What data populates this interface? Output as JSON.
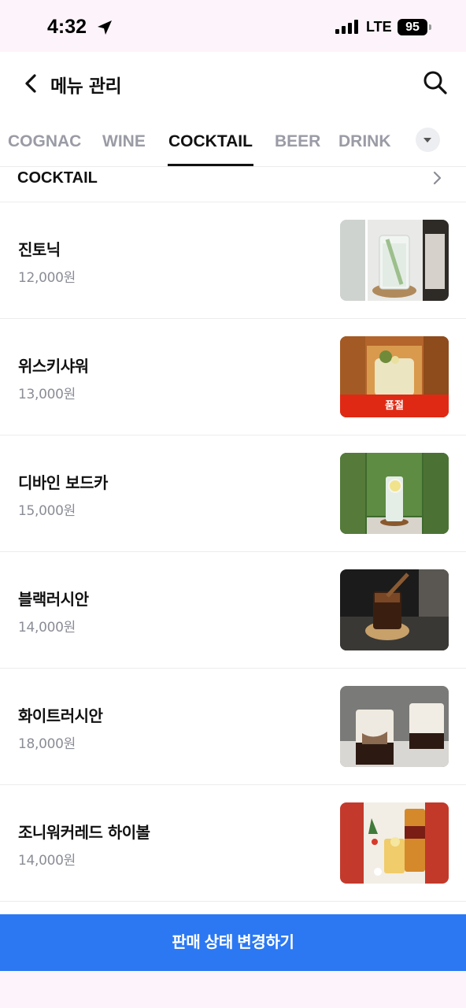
{
  "status_bar": {
    "time": "4:32",
    "network": "LTE",
    "battery": "95"
  },
  "header": {
    "title": "메뉴 관리"
  },
  "tabs": [
    {
      "label": "COGNAC",
      "active": false
    },
    {
      "label": "WINE",
      "active": false
    },
    {
      "label": "COCKTAIL",
      "active": true
    },
    {
      "label": "BEER",
      "active": false
    },
    {
      "label": "DRINK",
      "active": false
    }
  ],
  "section": {
    "title": "COCKTAIL"
  },
  "menu_items": [
    {
      "name": "진토닉",
      "price": "12,000원",
      "image": "gin-tonic-photo",
      "sold_out": false
    },
    {
      "name": "위스키샤워",
      "price": "13,000원",
      "image": "whisky-sour-photo",
      "sold_out": true,
      "badge": "품절"
    },
    {
      "name": "디바인 보드카",
      "price": "15,000원",
      "image": "divine-vodka-photo",
      "sold_out": false
    },
    {
      "name": "블랙러시안",
      "price": "14,000원",
      "image": "black-russian-photo",
      "sold_out": false
    },
    {
      "name": "화이트러시안",
      "price": "18,000원",
      "image": "white-russian-photo",
      "sold_out": false
    },
    {
      "name": "조니워커레드 하이볼",
      "price": "14,000원",
      "image": "johnnie-walker-highball-photo",
      "sold_out": false
    }
  ],
  "bottom_button": {
    "label": "판매 상태 변경하기"
  },
  "colors": {
    "primary": "#2b78f2",
    "soldout": "#e02914",
    "muted": "#8b8d96",
    "status_bg": "#fdf4fb"
  }
}
